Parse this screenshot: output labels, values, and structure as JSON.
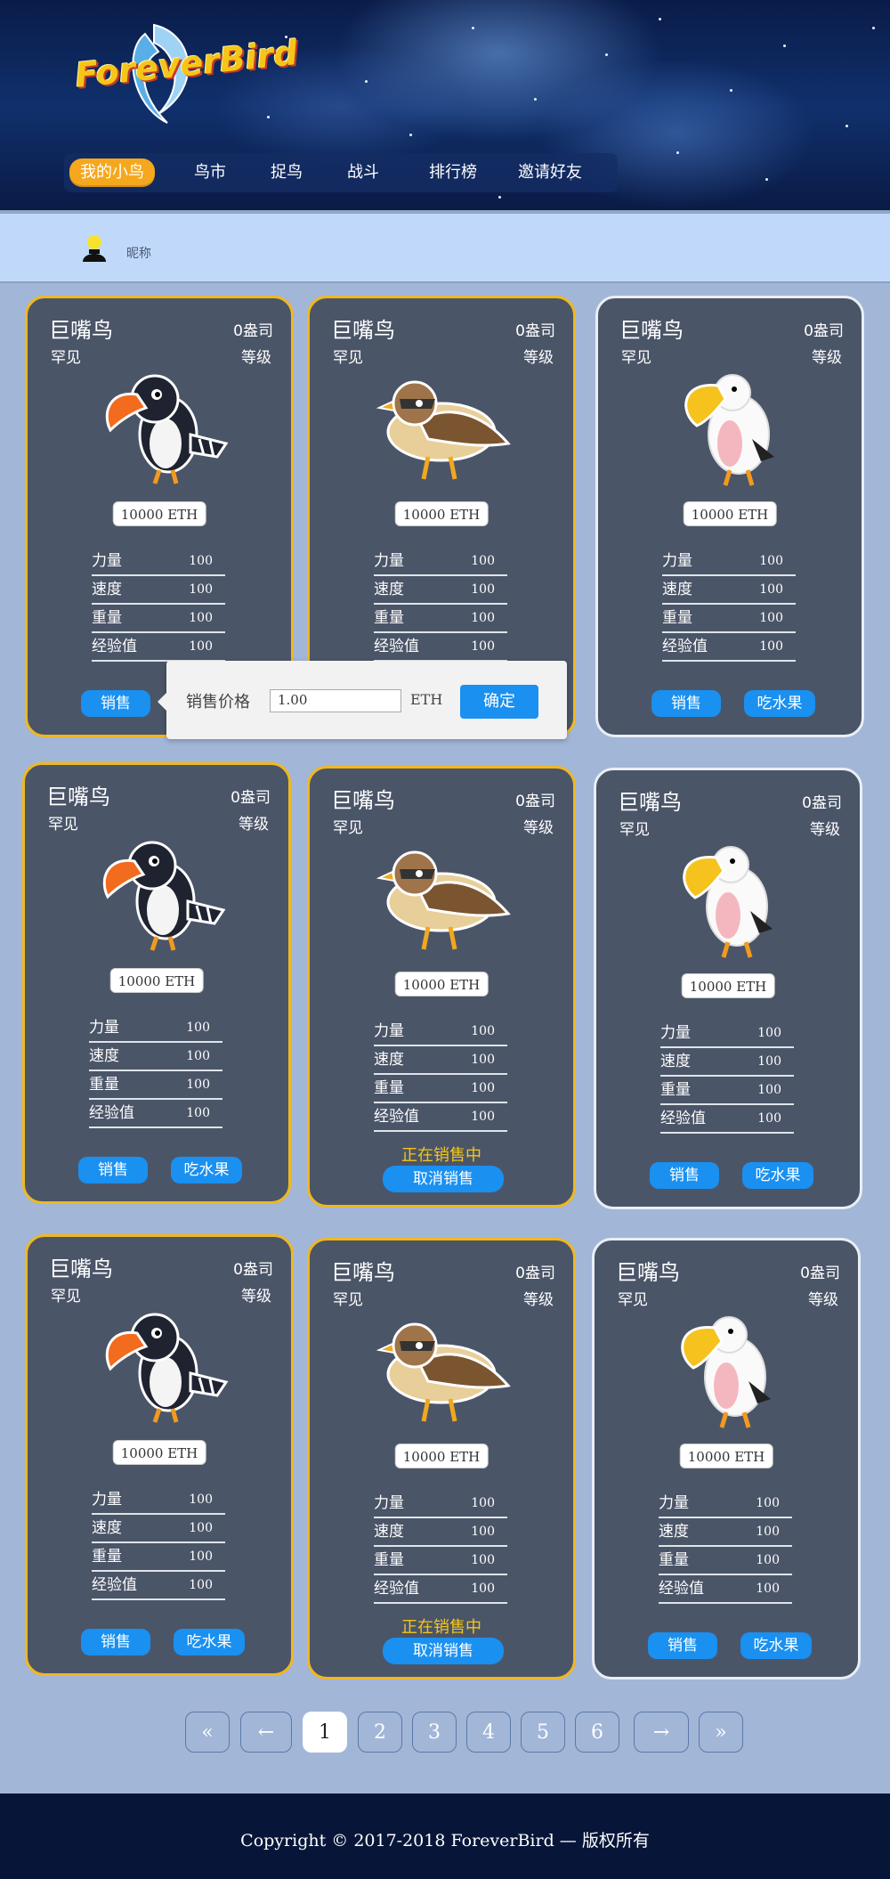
{
  "header": {
    "logo_text": "ForeverBird",
    "nav": [
      "我的小鸟",
      "鸟市",
      "捉鸟",
      "战斗",
      "排行榜",
      "邀请好友"
    ]
  },
  "user": {
    "nickname": "昵称"
  },
  "cards": [
    {
      "name": "巨嘴鸟",
      "rarity": "罕见",
      "box": "0盎司",
      "level": "等级",
      "price": "10000 ETH",
      "bird": "toucan-image",
      "stats": [
        [
          "力量",
          "100"
        ],
        [
          "速度",
          "100"
        ],
        [
          "重量",
          "100"
        ],
        [
          "经验值",
          "100"
        ]
      ],
      "actions": [
        "销售"
      ]
    },
    {
      "name": "巨嘴鸟",
      "rarity": "罕见",
      "box": "0盎司",
      "level": "等级",
      "price": "10000 ETH",
      "bird": "sparrow-image",
      "stats": [
        [
          "力量",
          "100"
        ],
        [
          "速度",
          "100"
        ],
        [
          "重量",
          "100"
        ],
        [
          "经验值",
          "100"
        ]
      ],
      "actions": []
    },
    {
      "name": "巨嘴鸟",
      "rarity": "罕见",
      "box": "0盎司",
      "level": "等级",
      "price": "10000 ETH",
      "bird": "pelican-image",
      "stats": [
        [
          "力量",
          "100"
        ],
        [
          "速度",
          "100"
        ],
        [
          "重量",
          "100"
        ],
        [
          "经验值",
          "100"
        ]
      ],
      "actions": [
        "销售",
        "吃水果"
      ]
    },
    {
      "name": "巨嘴鸟",
      "rarity": "罕见",
      "box": "0盎司",
      "level": "等级",
      "price": "10000 ETH",
      "bird": "toucan-image",
      "stats": [
        [
          "力量",
          "100"
        ],
        [
          "速度",
          "100"
        ],
        [
          "重量",
          "100"
        ],
        [
          "经验值",
          "100"
        ]
      ],
      "actions": [
        "销售",
        "吃水果"
      ]
    },
    {
      "name": "巨嘴鸟",
      "rarity": "罕见",
      "box": "0盎司",
      "level": "等级",
      "price": "10000 ETH",
      "bird": "sparrow-image",
      "stats": [
        [
          "力量",
          "100"
        ],
        [
          "速度",
          "100"
        ],
        [
          "重量",
          "100"
        ],
        [
          "经验值",
          "100"
        ]
      ],
      "on_sale": "正在销售中",
      "cancel": "取消销售"
    },
    {
      "name": "巨嘴鸟",
      "rarity": "罕见",
      "box": "0盎司",
      "level": "等级",
      "price": "10000 ETH",
      "bird": "pelican-image",
      "stats": [
        [
          "力量",
          "100"
        ],
        [
          "速度",
          "100"
        ],
        [
          "重量",
          "100"
        ],
        [
          "经验值",
          "100"
        ]
      ],
      "actions": [
        "销售",
        "吃水果"
      ]
    },
    {
      "name": "巨嘴鸟",
      "rarity": "罕见",
      "box": "0盎司",
      "level": "等级",
      "price": "10000 ETH",
      "bird": "toucan-image",
      "stats": [
        [
          "力量",
          "100"
        ],
        [
          "速度",
          "100"
        ],
        [
          "重量",
          "100"
        ],
        [
          "经验值",
          "100"
        ]
      ],
      "actions": [
        "销售",
        "吃水果"
      ]
    },
    {
      "name": "巨嘴鸟",
      "rarity": "罕见",
      "box": "0盎司",
      "level": "等级",
      "price": "10000 ETH",
      "bird": "sparrow-image",
      "stats": [
        [
          "力量",
          "100"
        ],
        [
          "速度",
          "100"
        ],
        [
          "重量",
          "100"
        ],
        [
          "经验值",
          "100"
        ]
      ],
      "on_sale": "正在销售中",
      "cancel": "取消销售"
    },
    {
      "name": "巨嘴鸟",
      "rarity": "罕见",
      "box": "0盎司",
      "level": "等级",
      "price": "10000 ETH",
      "bird": "pelican-image",
      "stats": [
        [
          "力量",
          "100"
        ],
        [
          "速度",
          "100"
        ],
        [
          "重量",
          "100"
        ],
        [
          "经验值",
          "100"
        ]
      ],
      "actions": [
        "销售",
        "吃水果"
      ]
    }
  ],
  "sell_popover": {
    "label": "销售价格",
    "value": "1.00",
    "unit": "ETH",
    "confirm": "确定"
  },
  "pagination": {
    "first": "«",
    "prev": "←",
    "pages": [
      "1",
      "2",
      "3",
      "4",
      "5",
      "6"
    ],
    "current": "1",
    "next": "→",
    "last": "»"
  },
  "footer": {
    "copyright": "Copyright © 2017-2018 ForeverBird — 版权所有"
  },
  "colors": {
    "accent": "#1a90f0",
    "gold_border": "#f0b81f",
    "card_bg": "#4b5568",
    "page_bg": "#a2b6d8",
    "on_sale": "#f5c518"
  }
}
